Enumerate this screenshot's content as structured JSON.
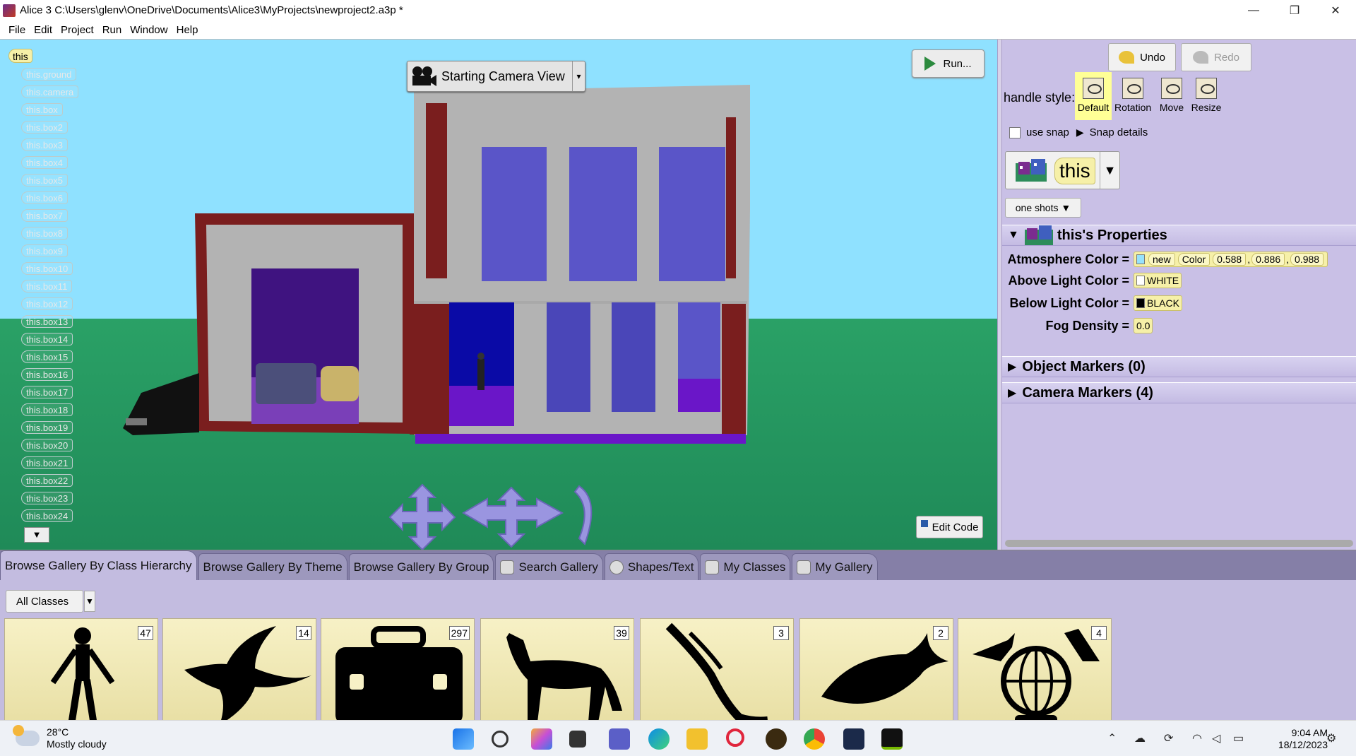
{
  "window": {
    "title": "Alice 3 C:\\Users\\glenv\\OneDrive\\Documents\\Alice3\\MyProjects\\newproject2.a3p *",
    "minimize": "—",
    "maximize": "❐",
    "close": "✕"
  },
  "menu": [
    "File",
    "Edit",
    "Project",
    "Run",
    "Window",
    "Help"
  ],
  "scene": {
    "root": "this",
    "tree": [
      "this.ground",
      "this.camera",
      "this.box",
      "this.box2",
      "this.box3",
      "this.box4",
      "this.box5",
      "this.box6",
      "this.box7",
      "this.box8",
      "this.box9",
      "this.box10",
      "this.box11",
      "this.box12",
      "this.box13",
      "this.box14",
      "this.box15",
      "this.box16",
      "this.box17",
      "this.box18",
      "this.box19",
      "this.box20",
      "this.box21",
      "this.box22",
      "this.box23",
      "this.box24"
    ],
    "more": "▼",
    "camera_view": "Starting Camera View",
    "camera_arrow": "▾",
    "run": "Run...",
    "edit_code": "Edit Code",
    "colors": {
      "sky": "#8fe1ff",
      "ground": "#2aa166",
      "wall": "#b3b3b3",
      "trim": "#7a1e1e",
      "window": "#5a55c8"
    }
  },
  "right_panel": {
    "undo": "Undo",
    "redo": "Redo",
    "handle_style_label": "handle style:",
    "handle_styles": [
      "Default",
      "Rotation",
      "Move",
      "Resize"
    ],
    "selected_handle_style": "Default",
    "use_snap": "use snap",
    "snap_details": "Snap details",
    "snap_tri": "▶",
    "selected_object": "this",
    "selected_arrow": "▼",
    "one_shots": "one shots ▼",
    "properties_title": "this's Properties",
    "tri_open": "▼",
    "tri_closed": "▶",
    "properties": {
      "atmosphere_label": "Atmosphere Color =",
      "atmosphere_new": "new",
      "atmosphere_class": "Color",
      "atmosphere_r": "0.588",
      "atmosphere_g": "0.886",
      "atmosphere_b": "0.988",
      "atmosphere_swatch": "#96e2fc",
      "above_label": "Above Light Color =",
      "above_value": "WHITE",
      "below_label": "Below Light Color =",
      "below_value": "BLACK",
      "fog_label": "Fog Density =",
      "fog_value": "0.0"
    },
    "object_markers": "Object Markers (0)",
    "camera_markers": "Camera Markers (4)"
  },
  "gallery": {
    "tabs": [
      "Browse Gallery By Class Hierarchy",
      "Browse Gallery By Theme",
      "Browse Gallery By Group",
      "Search Gallery",
      "Shapes/Text",
      "My Classes",
      "My Gallery"
    ],
    "active_tab": "Browse Gallery By Class Hierarchy",
    "filter": "All Classes",
    "filter_arrow": "▼",
    "cards": [
      {
        "icon": "biped-icon",
        "count": "47"
      },
      {
        "icon": "flyer-icon",
        "count": "14"
      },
      {
        "icon": "prop-toolbox-icon",
        "count": "297"
      },
      {
        "icon": "quadruped-icon",
        "count": "39"
      },
      {
        "icon": "slitherer-icon",
        "count": "3"
      },
      {
        "icon": "swimmer-icon",
        "count": "2"
      },
      {
        "icon": "transport-icon",
        "count": "4"
      }
    ]
  },
  "taskbar": {
    "temperature": "28°C",
    "weather": "Mostly cloudy",
    "time": "9:04 AM",
    "date": "18/12/2023"
  }
}
